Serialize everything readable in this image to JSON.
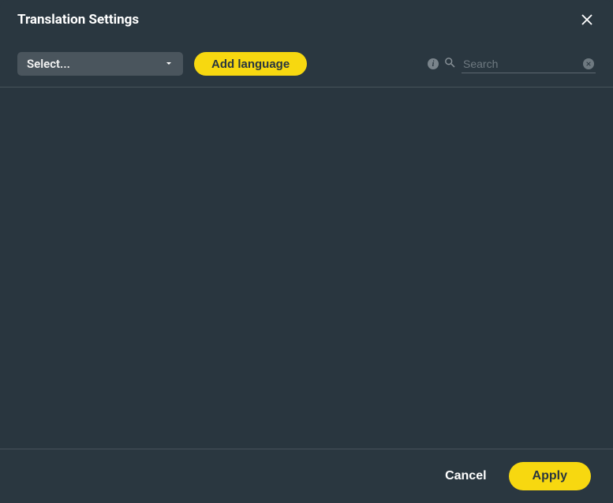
{
  "header": {
    "title": "Translation Settings"
  },
  "toolbar": {
    "select_placeholder": "Select...",
    "add_language_label": "Add language"
  },
  "search": {
    "placeholder": "Search",
    "value": ""
  },
  "footer": {
    "cancel_label": "Cancel",
    "apply_label": "Apply"
  }
}
